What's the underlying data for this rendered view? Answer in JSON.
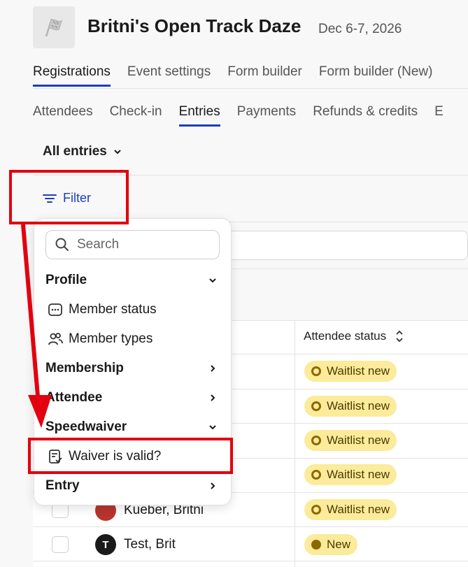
{
  "header": {
    "event_title": "Britni's Open Track Daze",
    "event_date": "Dec 6-7, 2026",
    "logo_icon": "checkered-flag-icon"
  },
  "main_tabs": [
    {
      "label": "Registrations",
      "active": true
    },
    {
      "label": "Event settings",
      "active": false
    },
    {
      "label": "Form builder",
      "active": false
    },
    {
      "label": "Form builder (New)",
      "active": false
    }
  ],
  "sub_tabs": [
    {
      "label": "Attendees",
      "active": false
    },
    {
      "label": "Check-in",
      "active": false
    },
    {
      "label": "Entries",
      "active": true
    },
    {
      "label": "Payments",
      "active": false
    },
    {
      "label": "Refunds & credits",
      "active": false
    },
    {
      "label": "E",
      "active": false
    }
  ],
  "view_selector": {
    "label": "All entries"
  },
  "filter_button": {
    "label": "Filter"
  },
  "table": {
    "column_header": "Attendee status",
    "rows": [
      {
        "name": "",
        "status": "Waitlist new"
      },
      {
        "name": "",
        "status": "Waitlist new"
      },
      {
        "name": "",
        "status": "Waitlist new"
      },
      {
        "name": "",
        "status": "Waitlist new"
      },
      {
        "name": "Kueber, Britni",
        "status": "Waitlist new"
      },
      {
        "name": "Test, Brit",
        "status": "New",
        "avatar_initial": "T"
      }
    ]
  },
  "filter_dropdown": {
    "search_placeholder": "Search",
    "sections": {
      "profile": "Profile",
      "member_status": "Member status",
      "member_types": "Member types",
      "membership": "Membership",
      "attendee": "Attendee",
      "speedwaiver": "Speedwaiver",
      "waiver_valid": "Waiver is valid?",
      "entry": "Entry"
    }
  },
  "colors": {
    "accent": "#1d3fb8",
    "badge_bg": "#fbeb9a",
    "annotation_red": "#e3000f"
  }
}
